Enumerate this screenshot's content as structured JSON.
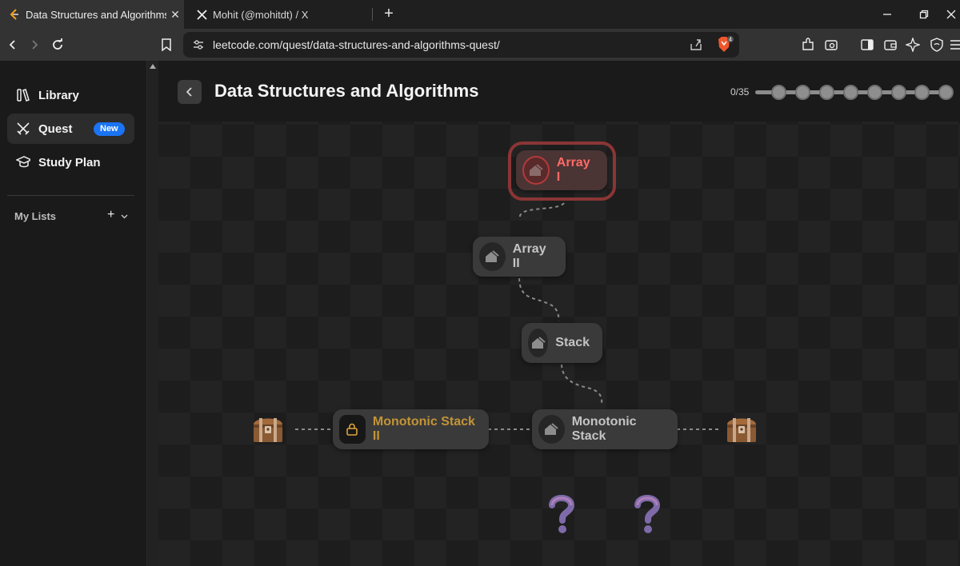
{
  "browser": {
    "tabs": [
      {
        "title": "Data Structures and Algorithms",
        "icon": "leetcode-icon",
        "active": true
      },
      {
        "title": "Mohit (@mohitdt) / X",
        "icon": "x-logo-icon",
        "active": false
      }
    ],
    "url": "leetcode.com/quest/data-structures-and-algorithms-quest/",
    "brave_badge": "4"
  },
  "sidebar": {
    "items": [
      {
        "label": "Library",
        "icon": "library-icon"
      },
      {
        "label": "Quest",
        "icon": "swords-icon",
        "badge": "New",
        "active": true
      },
      {
        "label": "Study Plan",
        "icon": "graduation-cap-icon"
      }
    ],
    "my_lists": "My Lists"
  },
  "header": {
    "title": "Data Structures and Algorithms",
    "progress": "0/35",
    "progress_completed": 0,
    "progress_total": 35
  },
  "map": {
    "nodes": [
      {
        "label": "Array I",
        "state": "current"
      },
      {
        "label": "Array II",
        "state": "available"
      },
      {
        "label": "Stack",
        "state": "available"
      },
      {
        "label": "Monotonic Stack",
        "state": "available"
      },
      {
        "label": "Monotonic Stack II",
        "state": "locked"
      }
    ]
  },
  "colors": {
    "accent_badge": "#1a74f3",
    "current_node_text": "#ff6a66",
    "locked_node_text": "#c39436"
  }
}
